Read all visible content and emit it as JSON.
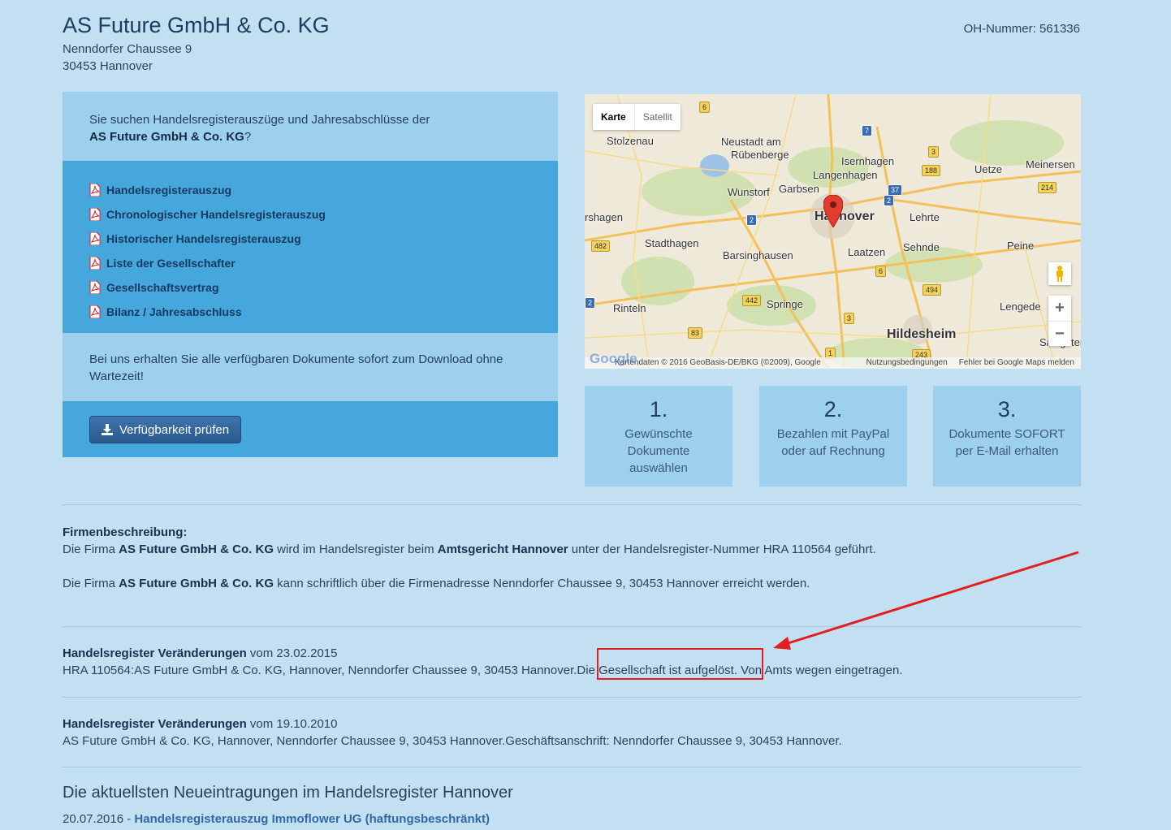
{
  "header": {
    "company": "AS Future GmbH & Co. KG",
    "street": "Nenndorfer Chaussee 9",
    "city": "30453 Hannover",
    "oh_number": "OH-Nummer: 561336"
  },
  "intro": {
    "text_before": "Sie suchen Handelsregisterauszüge und Jahresabschlüsse der",
    "company": "AS Future GmbH & Co. KG",
    "text_after": "?"
  },
  "documents": [
    "Handelsregisterauszug",
    "Chronologischer Handelsregisterauszug",
    "Historischer Handelsregisterauszug",
    "Liste der Gesellschafter",
    "Gesellschaftsvertrag",
    "Bilanz / Jahresabschluss"
  ],
  "note": "Bei uns erhalten Sie alle verfügbaren Dokumente sofort zum Download ohne Wartezeit!",
  "check_button": "Verfügbarkeit prüfen",
  "map": {
    "type_map": "Karte",
    "type_satellite": "Satellit",
    "zoom_in": "+",
    "zoom_out": "−",
    "attribution": "Kartendaten © 2016 GeoBasis-DE/BKG (©2009), Google",
    "terms": "Nutzungsbedingungen",
    "report": "Fehler bei Google Maps melden",
    "places": [
      "Stolzenau",
      "Neustadt am",
      "Rübenberge",
      "Isernhagen",
      "Langenhagen",
      "Uetze",
      "Meinersen",
      "Wunstorf",
      "Garbsen",
      "Hannover",
      "Lehrte",
      "rshagen",
      "Stadthagen",
      "Sehnde",
      "Peine",
      "Barsinghausen",
      "Laatzen",
      "Springe",
      "Rinteln",
      "Lengede",
      "Hildesheim",
      "Salzgitter"
    ],
    "road_numbers": [
      "6",
      "7",
      "3",
      "188",
      "37",
      "2",
      "214",
      "2",
      "482",
      "6",
      "494",
      "442",
      "3",
      "83",
      "1",
      "243",
      "2"
    ]
  },
  "steps": [
    {
      "num": "1.",
      "text": "Gewünschte Dokumente auswählen"
    },
    {
      "num": "2.",
      "text": "Bezahlen mit PayPal oder auf Rechnung"
    },
    {
      "num": "3.",
      "text": "Dokumente SOFORT per E-Mail erhalten"
    }
  ],
  "description": {
    "heading": "Firmenbeschreibung:",
    "p1_a": "Die Firma ",
    "p1_company": "AS Future GmbH & Co. KG",
    "p1_b": " wird im Handelsregister beim ",
    "p1_court": "Amtsgericht Hannover",
    "p1_c": " unter der Handelsregister-Nummer HRA 110564 geführt.",
    "p2_a": "Die Firma ",
    "p2_company": "AS Future GmbH & Co. KG",
    "p2_b": " kann schriftlich über die Firmenadresse Nenndorfer Chaussee 9, 30453 Hannover erreicht werden."
  },
  "changes": [
    {
      "heading": "Handelsregister Veränderungen",
      "date": " vom 23.02.2015",
      "text": "HRA 110564:AS Future GmbH & Co. KG, Hannover, Nenndorfer Chaussee 9, 30453 Hannover.Die Gesellschaft ist aufgelöst. Von Amts wegen eingetragen."
    },
    {
      "heading": "Handelsregister Veränderungen",
      "date": " vom 19.10.2010",
      "text": "AS Future GmbH & Co. KG, Hannover, Nenndorfer Chaussee 9, 30453 Hannover.Geschäftsanschrift: Nenndorfer Chaussee 9, 30453 Hannover."
    }
  ],
  "newest": {
    "title": "Die aktuellsten Neueintragungen im Handelsregister Hannover",
    "date": "20.07.2016 - ",
    "link": "Handelsregisterauszug Immoflower UG (haftungsbeschränkt)"
  },
  "colors": {
    "background": "#c3e0f2",
    "panel_light": "#9dd0ec",
    "panel_dark": "#46a7dc",
    "button": "#2a5a8e",
    "annotation_red": "#e21f1f"
  }
}
